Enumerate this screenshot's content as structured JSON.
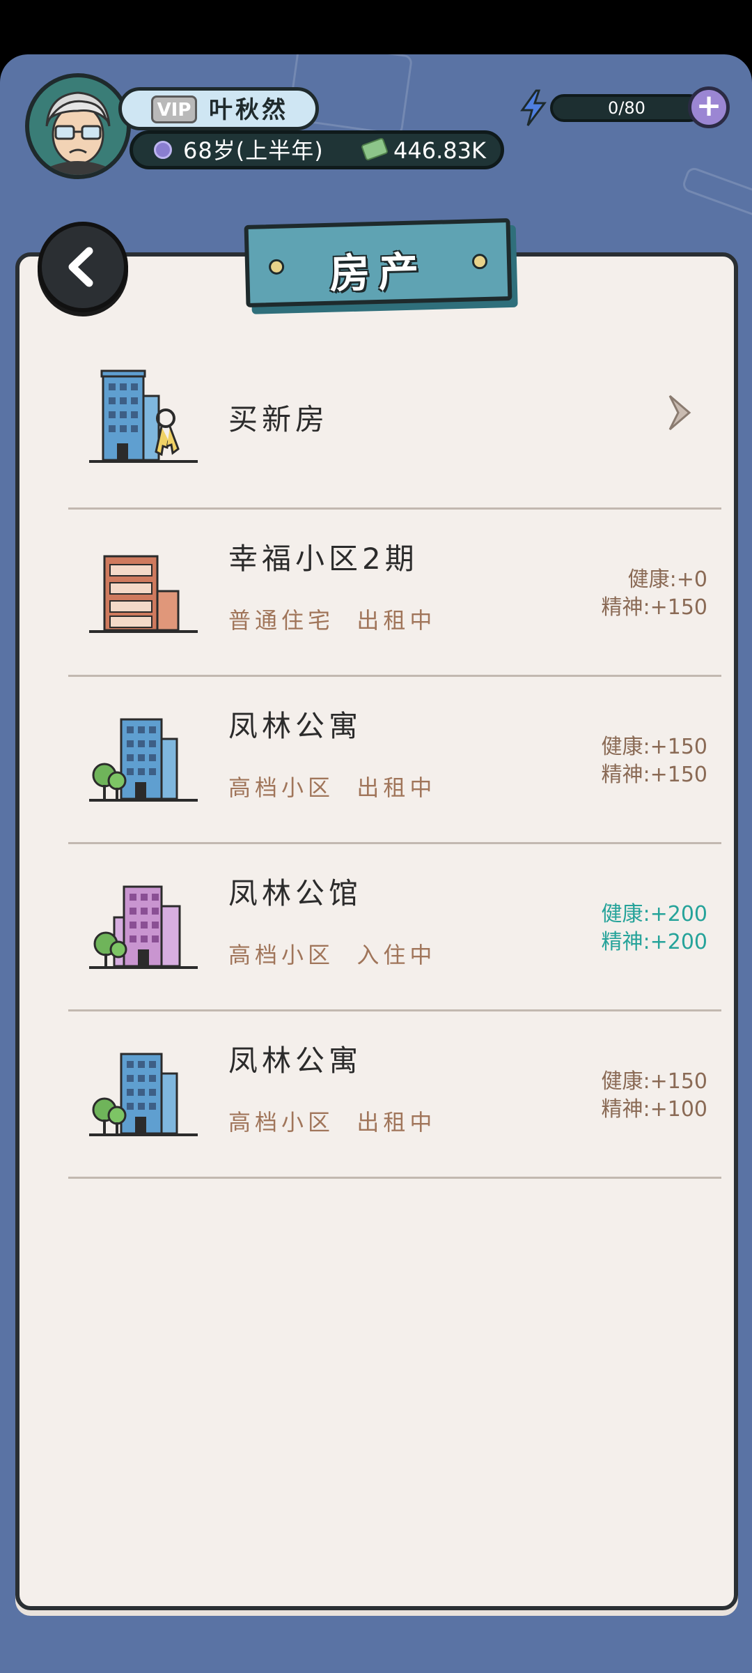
{
  "player": {
    "vip_label": "VIP",
    "name": "叶秋然",
    "age": "68岁(上半年)",
    "money": "446.83K"
  },
  "energy": {
    "text": "0/80",
    "plus": "+"
  },
  "panel": {
    "title": "房产"
  },
  "buy": {
    "label": "买新房"
  },
  "properties": [
    {
      "name": "幸福小区2期",
      "type": "普通住宅",
      "status": "出租中",
      "health": "健康:+0",
      "spirit": "精神:+150"
    },
    {
      "name": "凤林公寓",
      "type": "高档小区",
      "status": "出租中",
      "health": "健康:+150",
      "spirit": "精神:+150"
    },
    {
      "name": "凤林公馆",
      "type": "高档小区",
      "status": "入住中",
      "health": "健康:+200",
      "spirit": "精神:+200"
    },
    {
      "name": "凤林公寓",
      "type": "高档小区",
      "status": "出租中",
      "health": "健康:+150",
      "spirit": "精神:+100"
    }
  ],
  "colors": {
    "background": "#5a73a4",
    "paper": "#f4efeb",
    "banner": "#5fa3b3",
    "stat_active": "#26a39a",
    "stat_normal": "#8a6a55"
  }
}
